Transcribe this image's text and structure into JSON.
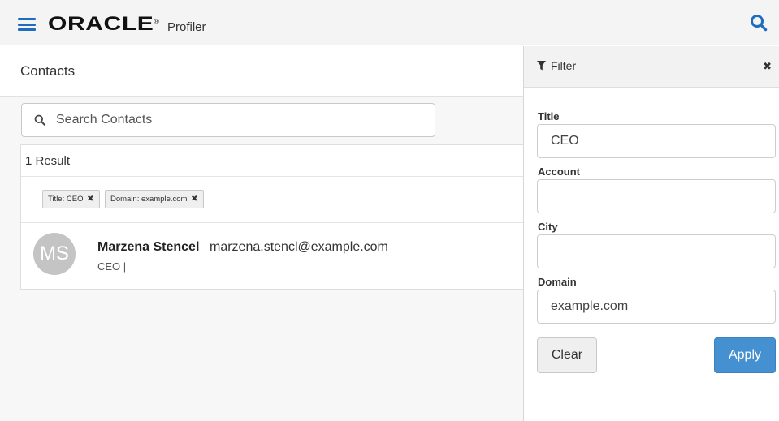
{
  "header": {
    "brand": "ORACLE",
    "brand_mark": "®",
    "product": "Profiler",
    "menu_icon": "hamburger-menu-icon",
    "search_icon": "search-icon",
    "accent_color": "#1f6dbd"
  },
  "contacts": {
    "title": "Contacts",
    "search_placeholder": "Search Contacts",
    "result_count": "1 Result",
    "active_filters": [
      {
        "label": "Title: CEO",
        "remove_icon": "close-icon"
      },
      {
        "label": "Domain: example.com",
        "remove_icon": "close-icon"
      }
    ],
    "results": [
      {
        "initials": "MS",
        "name": "Marzena Stencel",
        "email": "marzena.stencl@example.com",
        "subtitle": "CEO |"
      }
    ]
  },
  "filter": {
    "title": "Filter",
    "filter_icon": "funnel-icon",
    "close_icon": "close-icon",
    "fields": [
      {
        "label": "Title",
        "value": "CEO"
      },
      {
        "label": "Account",
        "value": ""
      },
      {
        "label": "City",
        "value": ""
      },
      {
        "label": "Domain",
        "value": "example.com"
      }
    ],
    "clear_label": "Clear",
    "apply_label": "Apply",
    "apply_color": "#4590d1"
  }
}
